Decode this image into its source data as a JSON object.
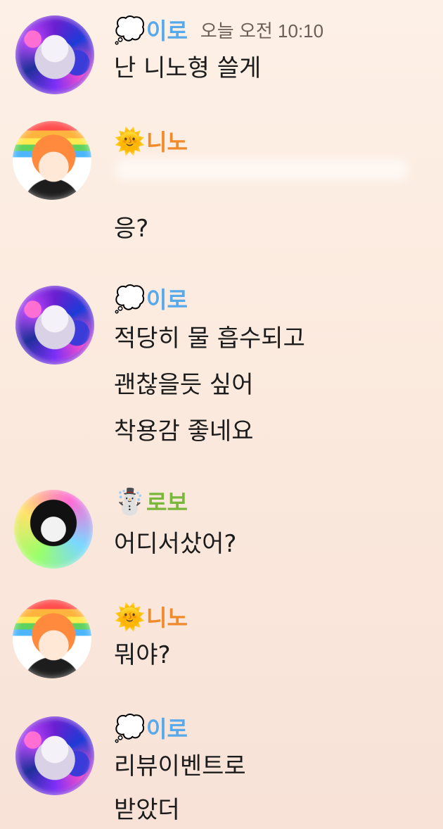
{
  "colors": {
    "iro_name": "#56a9ea",
    "nino_name": "#f08a2a",
    "robo_name": "#79b83a"
  },
  "messages": [
    {
      "sender": "이로",
      "emoji": "💭",
      "avatar_icon": "iro-avatar",
      "time": "오늘 오전 10:10",
      "lines": [
        "난 니노형 쓸게"
      ]
    },
    {
      "sender": "니노",
      "emoji": "🌞",
      "avatar_icon": "nino-avatar",
      "lines": [
        "응?"
      ]
    },
    {
      "sender": "이로",
      "emoji": "💭",
      "avatar_icon": "iro-avatar",
      "lines": [
        "적당히 물 흡수되고",
        "괜찮을듯 싶어",
        "착용감 좋네요"
      ]
    },
    {
      "sender": "로보",
      "emoji": "☃️",
      "avatar_icon": "robo-avatar",
      "lines": [
        "어디서샀어?"
      ]
    },
    {
      "sender": "니노",
      "emoji": "🌞",
      "avatar_icon": "nino-avatar",
      "lines": [
        "뭐야?"
      ]
    },
    {
      "sender": "이로",
      "emoji": "💭",
      "avatar_icon": "iro-avatar",
      "lines": [
        "리뷰이벤트로",
        "받았더"
      ]
    }
  ]
}
